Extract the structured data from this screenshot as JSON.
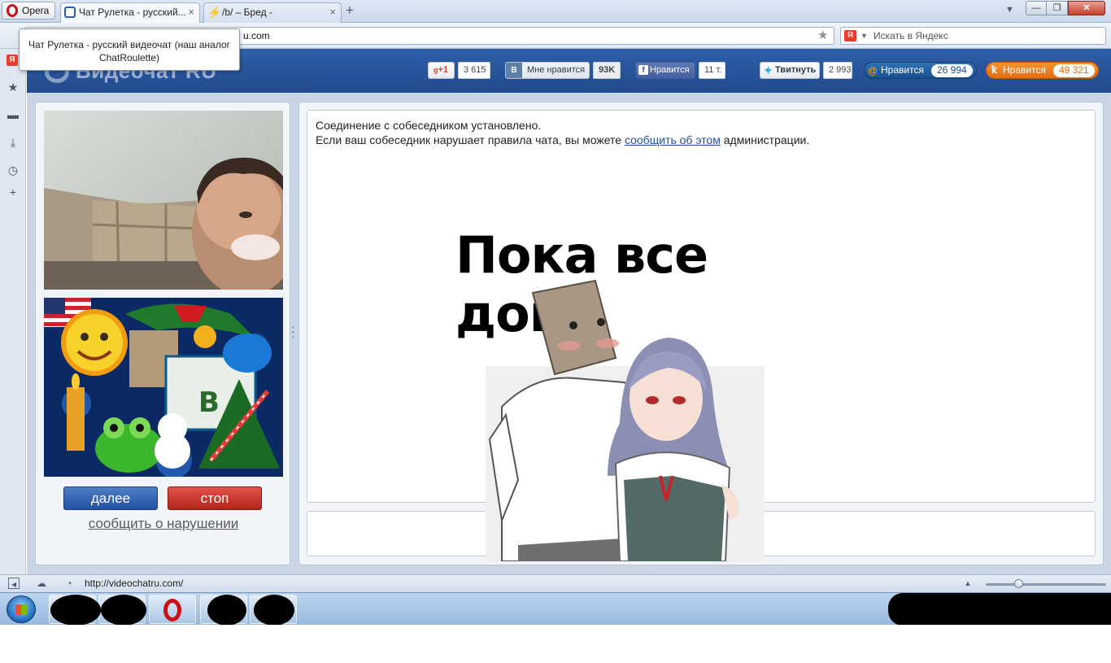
{
  "browser": {
    "menu_label": "Opera",
    "tabs": [
      {
        "label": "Чат Рулетка - русский...",
        "active": true
      },
      {
        "label": "/b/ – Бред -",
        "active": false
      }
    ],
    "url": "u.com",
    "search_placeholder": "Искать в Яндекс",
    "search_engine_badge": "Я",
    "tooltip": "Чат Рулетка - русский видеочат (наш аналог ChatRoulette)",
    "status_url": "http://videochatru.com/"
  },
  "site": {
    "logo_text": "Видеочат RU",
    "social": {
      "gplus": {
        "label": "+1",
        "count": "3 615"
      },
      "vk": {
        "icon": "В",
        "label": "Мне нравится",
        "count": "93K"
      },
      "facebook": {
        "label": "Нравится",
        "count": "11 т."
      },
      "twitter": {
        "label": "Твитнуть",
        "count": "2 993"
      },
      "mailru": {
        "label": "Нравится",
        "count": "26 994"
      },
      "odnoklassniki": {
        "label": "Нравится",
        "count": "49 321"
      }
    },
    "colors": {
      "header": "#2a569b",
      "next_button": "#2f5fae",
      "stop_button": "#c7332b",
      "mailru_pill": "#1d5c9d",
      "ok_pill": "#f07d1b"
    }
  },
  "controls": {
    "next_label": "далее",
    "stop_label": "стоп",
    "report_label": "сообщить о нарушении"
  },
  "chat": {
    "line1": "Соединение с собеседником установлено.",
    "line2_before": "Если ваш собеседник нарушает правила чата, вы можете ",
    "line2_link": "сообщить об этом",
    "line2_after": " администрации."
  },
  "overlay": {
    "caption": "Пока все дома"
  }
}
